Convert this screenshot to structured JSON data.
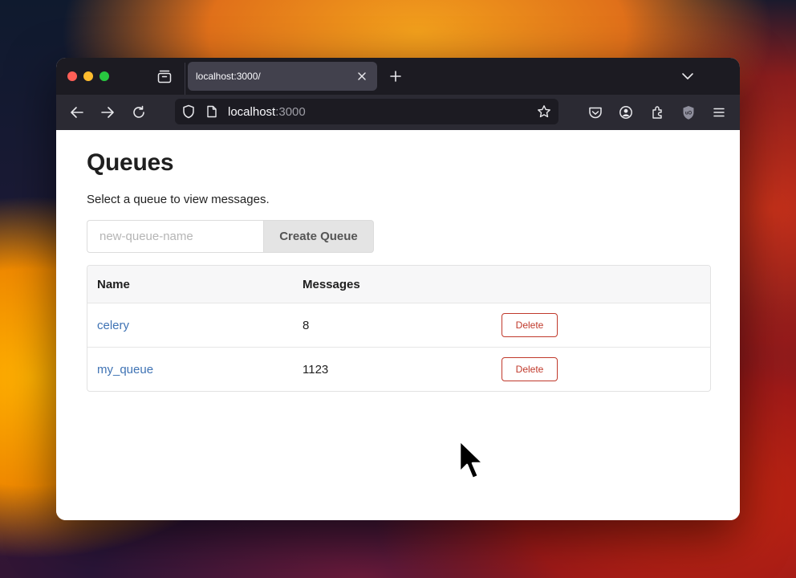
{
  "browser": {
    "tab": {
      "title": "localhost:3000/"
    },
    "url": {
      "host": "localhost",
      "port": ":3000"
    }
  },
  "page": {
    "title": "Queues",
    "subtitle": "Select a queue to view messages.",
    "create_form": {
      "placeholder": "new-queue-name",
      "button_label": "Create Queue"
    },
    "table": {
      "columns": [
        "Name",
        "Messages",
        ""
      ],
      "rows": [
        {
          "name": "celery",
          "messages": "8",
          "action": "Delete"
        },
        {
          "name": "my_queue",
          "messages": "1123",
          "action": "Delete"
        }
      ]
    }
  },
  "colors": {
    "link": "#3f73b4",
    "danger": "#c0392b",
    "chrome_dark": "#1c1b22"
  },
  "icons": [
    "close-window-dot",
    "minimize-window-dot",
    "zoom-window-dot",
    "tab-tray-icon",
    "close-icon",
    "plus-icon",
    "chevron-down-icon",
    "back-arrow-icon",
    "forward-arrow-icon",
    "reload-icon",
    "shield-icon",
    "page-icon",
    "star-icon",
    "pocket-icon",
    "account-icon",
    "extensions-icon",
    "ublock-icon",
    "menu-icon",
    "mouse-cursor-icon"
  ]
}
